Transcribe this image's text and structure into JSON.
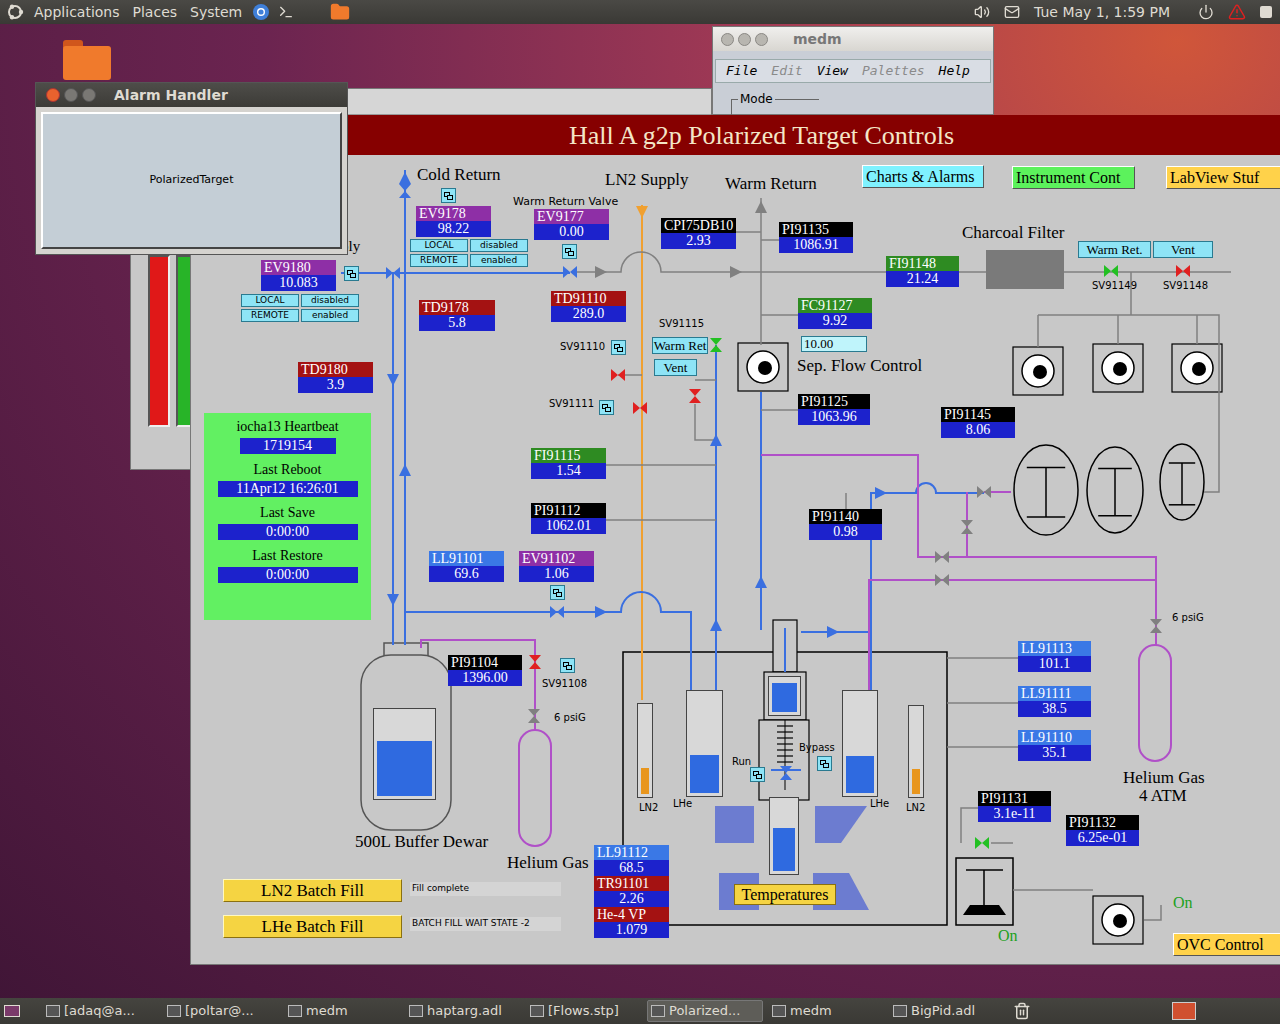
{
  "top_panel": {
    "menus": [
      "Applications",
      "Places",
      "System"
    ],
    "clock": "Tue May 1, 1:59 PM"
  },
  "background_window": {
    "alarm_bars": [
      {
        "color": "#e01818",
        "level": 1
      },
      {
        "color": "#28b428",
        "level": 1
      }
    ]
  },
  "alarm_handler": {
    "title": "Alarm Handler",
    "groups": [
      "PolarizedTarget"
    ]
  },
  "medm_window": {
    "title": "medm",
    "menus": [
      {
        "label": "File",
        "disabled": false
      },
      {
        "label": "Edit",
        "disabled": true
      },
      {
        "label": "View",
        "disabled": false
      },
      {
        "label": "Palettes",
        "disabled": true
      },
      {
        "label": "Help",
        "disabled": false
      }
    ],
    "group_label": "Mode"
  },
  "main_window": {
    "title": "Hall A g2p Polarized Target Controls",
    "nav_buttons": [
      {
        "label": "Charts & Alarms",
        "color": "#7ff2ff"
      },
      {
        "label": "Instrument Cont",
        "color": "#5cf25c"
      },
      {
        "label": "LabView Stuf",
        "color": "#ffd24a"
      },
      {
        "label": "OVC Control",
        "color": "#ffd24a"
      }
    ],
    "labels": [
      "Cold Return",
      "LN2 Supply",
      "Warm Return",
      "Charcoal Filter",
      "Warm Return Valve",
      "ply",
      "Sep. Flow Control",
      "500L Buffer Dewar",
      "Helium Gas",
      "Helium Gas",
      "4 ATM",
      "6 psiG",
      "6 psiG",
      "Run",
      "Bypass",
      "SV91115",
      "SV91110",
      "SV91111",
      "SV91108",
      "SV91149",
      "SV91148"
    ],
    "readouts": [
      {
        "tag": "EV9178",
        "value": "98.22",
        "color": "#8e2fa6"
      },
      {
        "tag": "EV9177",
        "value": "0.00",
        "color": "#8e2fa6"
      },
      {
        "tag": "EV9180",
        "value": "10.083",
        "color": "#8e2fa6"
      },
      {
        "tag": "TD9178",
        "value": "5.8",
        "color": "#a41212"
      },
      {
        "tag": "TD9180",
        "value": "3.9",
        "color": "#a41212"
      },
      {
        "tag": "CPI75DB10",
        "value": "2.93",
        "color": "#000000"
      },
      {
        "tag": "PI91135",
        "value": "1086.91",
        "color": "#000000"
      },
      {
        "tag": "FI91148",
        "value": "21.24",
        "color": "#2e8b22"
      },
      {
        "tag": "TD91110",
        "value": "289.0",
        "color": "#a41212"
      },
      {
        "tag": "FC91127",
        "value": "9.92",
        "color": "#2e8b22"
      },
      {
        "tag": "FI91115",
        "value": "1.54",
        "color": "#2e8b22"
      },
      {
        "tag": "PI91125",
        "value": "1063.96",
        "color": "#000000"
      },
      {
        "tag": "PI91145",
        "value": "8.06",
        "color": "#000000"
      },
      {
        "tag": "PI91112",
        "value": "1062.01",
        "color": "#000000"
      },
      {
        "tag": "PI91140",
        "value": "0.98",
        "color": "#000000"
      },
      {
        "tag": "LL91101",
        "value": "69.6",
        "color": "#3a78e6"
      },
      {
        "tag": "EV91102",
        "value": "1.06",
        "color": "#8e2fa6"
      },
      {
        "tag": "PI91104",
        "value": "1396.00",
        "color": "#000000"
      },
      {
        "tag": "LL91113",
        "value": "101.1",
        "color": "#3a78e6"
      },
      {
        "tag": "LL91111",
        "value": "38.5",
        "color": "#3a78e6"
      },
      {
        "tag": "LL91110",
        "value": "35.1",
        "color": "#3a78e6"
      },
      {
        "tag": "PI91131",
        "value": "3.1e-11",
        "color": "#000000"
      },
      {
        "tag": "PI91132",
        "value": "6.25e-01",
        "color": "#000000"
      },
      {
        "tag": "LL91112",
        "value": "68.5",
        "color": "#3a78e6"
      },
      {
        "tag": "TR91101",
        "value": "2.26",
        "color": "#a41212"
      },
      {
        "tag": "He-4 VP",
        "value": "1.079",
        "color": "#a41212"
      }
    ],
    "setpoint": {
      "value": "10.00"
    },
    "mode_panels": [
      {
        "buttons": [
          "LOCAL",
          "disabled",
          "REMOTE",
          "enabled"
        ]
      },
      {
        "buttons": [
          "LOCAL",
          "disabled",
          "REMOTE",
          "enabled"
        ]
      }
    ],
    "valve_buttons": [
      "Warm Ret.",
      "Vent",
      "Warm Ret",
      "Vent"
    ],
    "valves": [
      {
        "color": "#3a6fe0"
      },
      {
        "color": "#3a6fe0"
      },
      {
        "color": "#3a6fe0"
      },
      {
        "color": "#22c022"
      },
      {
        "color": "#e02020"
      },
      {
        "color": "#22c022"
      },
      {
        "color": "#e02020"
      },
      {
        "color": "#e02020"
      },
      {
        "color": "#e02020"
      },
      {
        "color": "#3a6fe0"
      },
      {
        "color": "#e02020"
      },
      {
        "color": "#808080"
      },
      {
        "color": "#808080"
      },
      {
        "color": "#808080"
      },
      {
        "color": "#808080"
      },
      {
        "color": "#808080"
      },
      {
        "color": "#808080"
      },
      {
        "color": "#22c022"
      },
      {
        "color": "#3a6fe0"
      }
    ],
    "gauges": [
      {
        "label": "LN2",
        "level": 0.3,
        "color": "#e8961e"
      },
      {
        "label": "LHe",
        "level": 0.38,
        "color": "#2f6ae0"
      },
      {
        "level": 0.9,
        "color": "#2f6ae0"
      },
      {
        "label": "LHe",
        "level": 0.37,
        "color": "#2f6ae0"
      },
      {
        "label": "LN2",
        "level": 0.3,
        "color": "#e8961e"
      },
      {
        "level": 0.62,
        "color": "#2f6ae0"
      },
      {
        "level": 0.65,
        "color": "#2f6ae0"
      }
    ],
    "heartbeat": {
      "title": "iocha13 Heartbeat",
      "counter": "1719154",
      "fields": [
        {
          "label": "Last Reboot",
          "value": "11Apr12 16:26:01"
        },
        {
          "label": "Last Save",
          "value": "0:00:00"
        },
        {
          "label": "Last Restore",
          "value": "0:00:00"
        }
      ]
    },
    "batch_fill": [
      {
        "button": "LN2 Batch Fill",
        "status": "Fill complete"
      },
      {
        "button": "LHe Batch Fill",
        "status": "BATCH FILL WAIT STATE -2"
      }
    ],
    "temperatures_button": "Temperatures",
    "pump_states": [
      "On",
      "On"
    ]
  },
  "taskbar": {
    "items": [
      {
        "label": "[adaq@a...",
        "selected": false
      },
      {
        "label": "[poltar@...",
        "selected": false
      },
      {
        "label": "medm",
        "selected": false
      },
      {
        "label": "haptarg.adl",
        "selected": false
      },
      {
        "label": "[Flows.stp]",
        "selected": false
      },
      {
        "label": "Polarized...",
        "selected": true
      },
      {
        "label": "medm",
        "selected": false
      },
      {
        "label": "BigPid.adl",
        "selected": false
      }
    ]
  }
}
